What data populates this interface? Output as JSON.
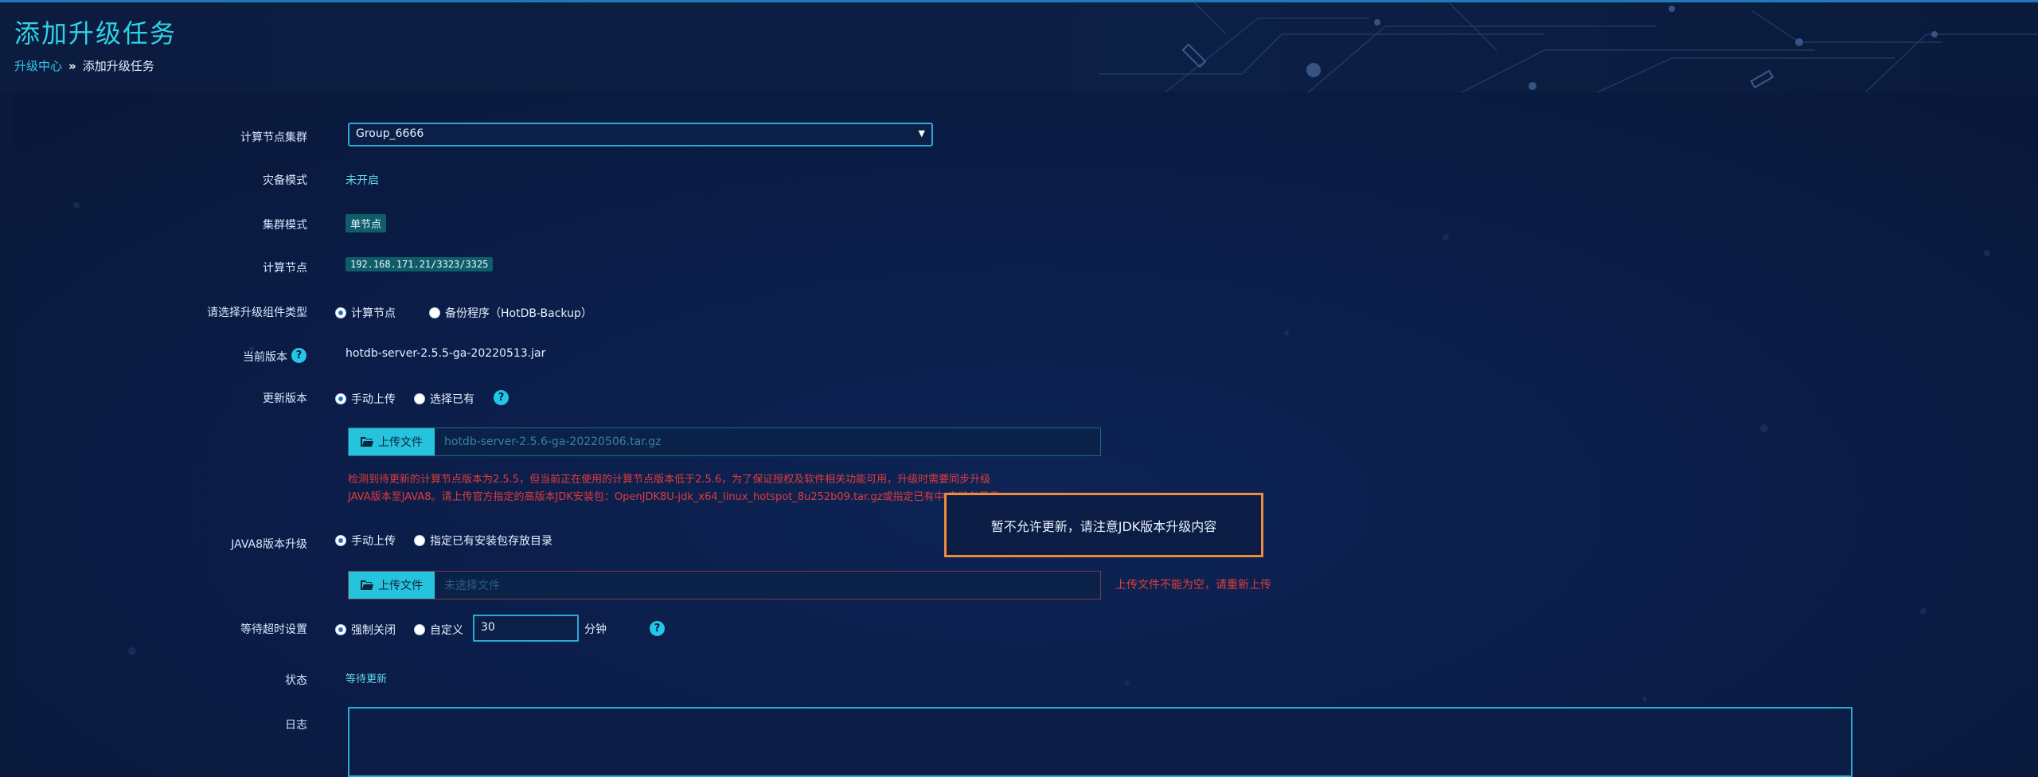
{
  "header": {
    "title": "添加升级任务",
    "breadcrumb": [
      {
        "label": "升级中心"
      },
      {
        "label": "»"
      },
      {
        "label": "添加升级任务"
      }
    ]
  },
  "form": {
    "cluster": {
      "label": "计算节点集群",
      "value": "Group_6666",
      "caret": "▼"
    },
    "disaster_mode": {
      "label": "灾备模式",
      "value": "未开启"
    },
    "cluster_mode": {
      "label": "集群模式",
      "value": "单节点"
    },
    "compute_node": {
      "label": "计算节点",
      "value": "192.168.171.21/3323/3325"
    },
    "component_type": {
      "label": "请选择升级组件类型",
      "options": [
        {
          "label": "计算节点",
          "selected": true
        },
        {
          "label": "备份程序（HotDB-Backup）",
          "selected": false
        }
      ]
    },
    "current_version": {
      "label": "当前版本",
      "value": "hotdb-server-2.5.5-ga-20220513.jar",
      "help": "?"
    },
    "update_version": {
      "label": "更新版本",
      "options": [
        {
          "label": "手动上传",
          "selected": true
        },
        {
          "label": "选择已有",
          "selected": false
        }
      ],
      "help": "?"
    },
    "upload1": {
      "button": "上传文件",
      "file": "hotdb-server-2.5.6-ga-20220506.tar.gz"
    },
    "warning_lines": [
      "检测到待更新的计算节点版本为2.5.5，但当前正在使用的计算节点版本低于2.5.6，为了保证授权及软件相关功能可用，升级时需要同步升级",
      "JAVA版本至JAVA8。请上传官方指定的高版本JDK安装包：OpenJDK8U-jdk_x64_linux_hotspot_8u252b09.tar.gz或指定已有中 安装包目录。"
    ],
    "java8": {
      "label": "JAVA8版本升级",
      "options": [
        {
          "label": "手动上传",
          "selected": true
        },
        {
          "label": "指定已有安装包存放目录",
          "selected": false
        }
      ]
    },
    "upload2": {
      "button": "上传文件",
      "placeholder": "未选择文件",
      "error": "上传文件不能为空，请重新上传"
    },
    "timeout": {
      "label": "等待超时设置",
      "options": [
        {
          "label": "强制关闭",
          "selected": true
        },
        {
          "label": "自定义",
          "selected": false
        }
      ],
      "value": "30",
      "unit": "分钟",
      "help": "?"
    },
    "status": {
      "label": "状态",
      "value": "等待更新"
    },
    "log": {
      "label": "日志"
    }
  },
  "toast": {
    "message": "暂不允许更新，请注意JDK版本升级内容"
  },
  "colors": {
    "accent": "#2fd3e6",
    "error": "#e23b3b",
    "toast_border": "#f08a3e",
    "background": "#0a1a3d"
  }
}
